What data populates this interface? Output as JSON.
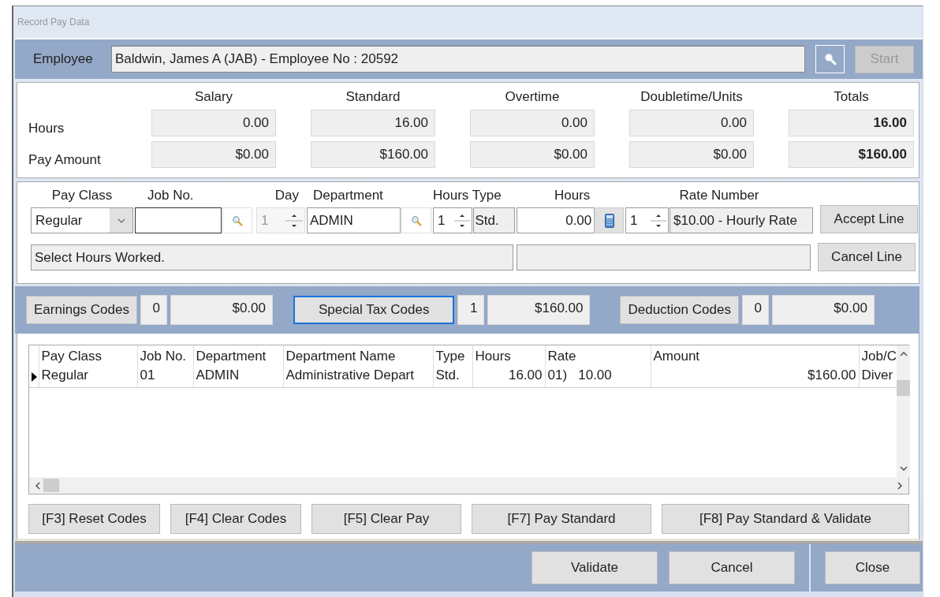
{
  "window": {
    "title": "Record Pay Data"
  },
  "employee": {
    "label": "Employee",
    "value": "Baldwin, James A (JAB) - Employee No : 20592",
    "start": {
      "label": "Start",
      "disabled": true
    }
  },
  "summary": {
    "columns": [
      "Salary",
      "Standard",
      "Overtime",
      "Doubletime/Units",
      "Totals"
    ],
    "rows": [
      {
        "label": "Hours",
        "values": [
          "0.00",
          "16.00",
          "0.00",
          "0.00",
          "16.00"
        ]
      },
      {
        "label": "Pay Amount",
        "values": [
          "$0.00",
          "$160.00",
          "$0.00",
          "$0.00",
          "$160.00"
        ]
      }
    ]
  },
  "entry": {
    "pay_class": {
      "label": "Pay Class",
      "value": "Regular"
    },
    "job_no": {
      "label": "Job No."
    },
    "day": {
      "label": "Day",
      "value": "1",
      "disabled": true
    },
    "department": {
      "label": "Department",
      "value": "ADMIN"
    },
    "hours_type": {
      "label": "Hours Type",
      "value": "1",
      "type": "Std."
    },
    "hours": {
      "label": "Hours",
      "value": "0.00"
    },
    "rate_number": {
      "label": "Rate Number",
      "value": "1",
      "rate": "$10.00 - Hourly Rate"
    },
    "message": "Select Hours Worked.",
    "buttons": [
      "Accept Line",
      "Cancel Line"
    ]
  },
  "codes": [
    {
      "label": "Earnings Codes",
      "count": "0",
      "amount": "$0.00",
      "selected": false
    },
    {
      "label": "Special Tax Codes",
      "count": "1",
      "amount": "$160.00",
      "selected": true
    },
    {
      "label": "Deduction Codes",
      "count": "0",
      "amount": "$0.00",
      "selected": false
    }
  ],
  "table": {
    "columns": [
      "Pay Class",
      "Job No.",
      "Department",
      "Department Name",
      "Type",
      "Hours",
      "Rate",
      "Amount",
      "Job/C"
    ],
    "rows": [
      {
        "current": true,
        "cells": [
          "Regular",
          "01",
          "ADMIN",
          "Administrative Depart",
          "Std.",
          "16.00",
          "01)   10.00",
          "$160.00",
          "Diver"
        ]
      }
    ]
  },
  "function_buttons": [
    "[F3] Reset Codes",
    "[F4] Clear Codes",
    "[F5] Clear Pay",
    "[F7] Pay Standard",
    "[F8] Pay Standard & Validate"
  ],
  "footer_buttons": [
    "Validate",
    "Cancel",
    "Close"
  ]
}
